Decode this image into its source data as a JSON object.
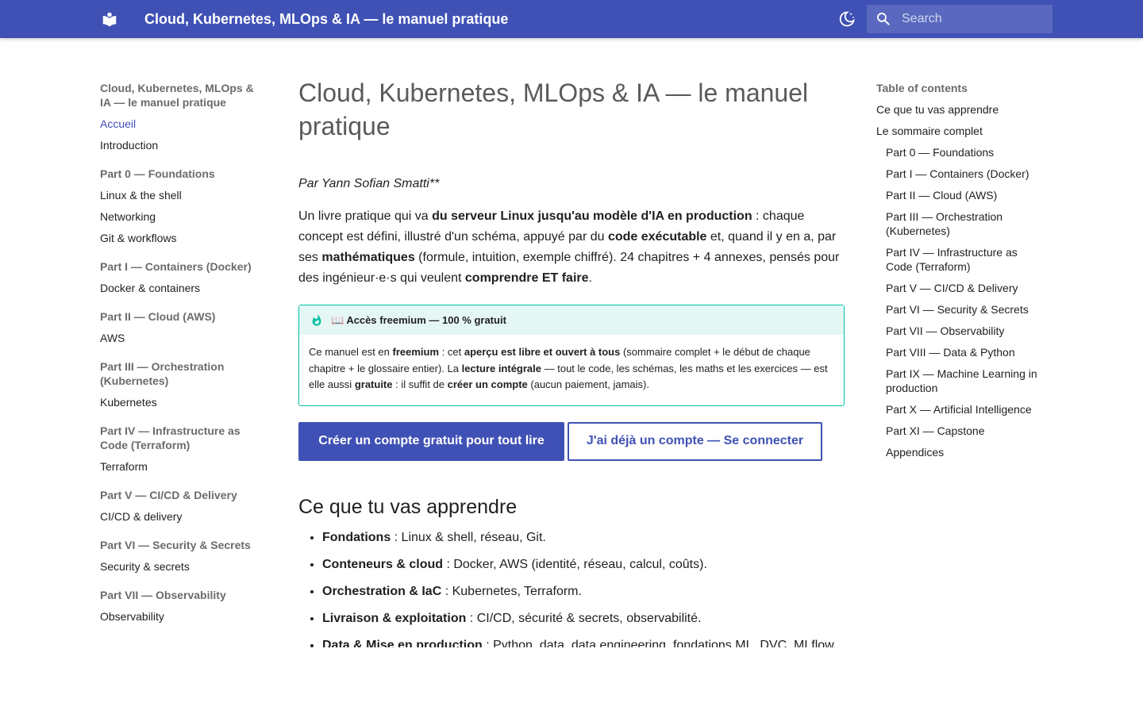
{
  "header": {
    "site_title": "Cloud, Kubernetes, MLOps & IA — le manuel pratique",
    "logo_icon": "book-open-icon",
    "theme_icon": "moon-icon",
    "search_icon": "search-icon",
    "search_placeholder": "Search",
    "accent_color": "#3f51b5"
  },
  "nav": {
    "title": "Cloud, Kubernetes, MLOps & IA — le manuel pratique",
    "top_links": [
      "Accueil",
      "Introduction"
    ],
    "sections": [
      {
        "title": "Part 0 — Foundations",
        "links": [
          "Linux & the shell",
          "Networking",
          "Git & workflows"
        ]
      },
      {
        "title": "Part I — Containers (Docker)",
        "links": [
          "Docker & containers"
        ]
      },
      {
        "title": "Part II — Cloud (AWS)",
        "links": [
          "AWS"
        ]
      },
      {
        "title": "Part III — Orchestration (Kubernetes)",
        "links": [
          "Kubernetes"
        ]
      },
      {
        "title": "Part IV — Infrastructure as Code (Terraform)",
        "links": [
          "Terraform"
        ]
      },
      {
        "title": "Part V — CI/CD & Delivery",
        "links": [
          "CI/CD & delivery"
        ]
      },
      {
        "title": "Part VI — Security & Secrets",
        "links": [
          "Security & secrets"
        ]
      },
      {
        "title": "Part VII — Observability",
        "links": [
          "Observability"
        ]
      }
    ]
  },
  "content": {
    "title": "Cloud, Kubernetes, MLOps & IA — le manuel pratique",
    "byline": "Par Yann Sofian Smatti**",
    "intro": {
      "t1": "Un livre pratique qui va ",
      "b1": "du serveur Linux jusqu'au modèle d'IA en production",
      "t2": " : chaque concept est défini, illustré d'un schéma, appuyé par du ",
      "b2": "code exécutable",
      "t3": " et, quand il y en a, par ses ",
      "b3": "mathématiques",
      "t4": " (formule, intuition, exemple chiffré). 24 chapitres + 4 annexes, pensés pour des ingénieur·e·s qui veulent ",
      "b4": "comprendre ET faire",
      "t5": "."
    },
    "admonition": {
      "icon": "flame-icon",
      "title": "📖 Accès freemium — 100 % gratuit",
      "t1": "Ce manuel est en ",
      "b1": "freemium",
      "t2": " : cet ",
      "b2": "aperçu est libre et ouvert à tous",
      "t3": " (sommaire complet + le début de chaque chapitre + le glossaire entier). La ",
      "b3": "lecture intégrale",
      "t4": " — tout le code, les schémas, les maths et les exercices — est elle aussi ",
      "b4": "gratuite",
      "t5": " : il suffit de ",
      "b5": "créer un compte",
      "t6": " (aucun paiement, jamais).",
      "border_color": "#00bfa5",
      "bg_color": "#e5f7f4"
    },
    "cta_primary": "Créer un compte gratuit pour tout lire",
    "cta_secondary": "J'ai déjà un compte — Se connecter",
    "section_title": "Ce que tu vas apprendre",
    "learn_items": [
      {
        "term": "Fondations",
        "desc": " : Linux & shell, réseau, Git."
      },
      {
        "term": "Conteneurs & cloud",
        "desc": " : Docker, AWS (identité, réseau, calcul, coûts)."
      },
      {
        "term": "Orchestration & IaC",
        "desc": " : Kubernetes, Terraform."
      },
      {
        "term": "Livraison & exploitation",
        "desc": " : CI/CD, sécurité & secrets, observabilité."
      },
      {
        "term": "Data & Mise en production",
        "desc": " : Python, data, data engineering, fondations ML, DVC, MLflow."
      }
    ]
  },
  "toc": {
    "title": "Table of contents",
    "top_links": [
      "Ce que tu vas apprendre",
      "Le sommaire complet"
    ],
    "sub_links": [
      "Part 0 — Foundations",
      "Part I — Containers (Docker)",
      "Part II — Cloud (AWS)",
      "Part III — Orchestration (Kubernetes)",
      "Part IV — Infrastructure as Code (Terraform)",
      "Part V — CI/CD & Delivery",
      "Part VI — Security & Secrets",
      "Part VII — Observability",
      "Part VIII — Data & Python",
      "Part IX — Machine Learning in production",
      "Part X — Artificial Intelligence",
      "Part XI — Capstone",
      "Appendices"
    ]
  }
}
